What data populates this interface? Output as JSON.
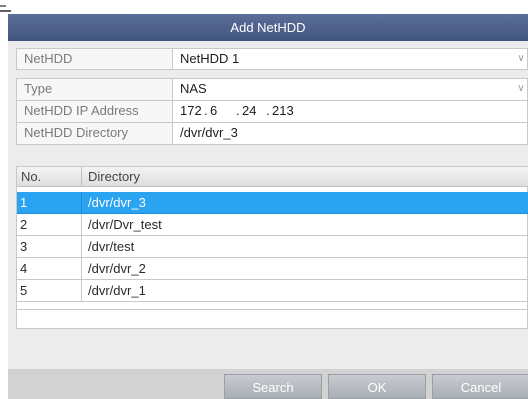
{
  "dialog": {
    "title": "Add NetHDD"
  },
  "form": {
    "nethdd": {
      "label": "NetHDD",
      "value": "NetHDD 1"
    },
    "type": {
      "label": "Type",
      "value": "NAS"
    },
    "ip": {
      "label": "NetHDD IP Address",
      "octets": [
        "172",
        "6",
        "24",
        "213"
      ]
    },
    "directory": {
      "label": "NetHDD Directory",
      "value": "/dvr/dvr_3"
    }
  },
  "table": {
    "headers": [
      "No.",
      "Directory"
    ],
    "rows": [
      {
        "no": "1",
        "dir": "/dvr/dvr_3",
        "selected": true
      },
      {
        "no": "2",
        "dir": "/dvr/Dvr_test"
      },
      {
        "no": "3",
        "dir": "/dvr/test"
      },
      {
        "no": "4",
        "dir": "/dvr/dvr_2"
      },
      {
        "no": "5",
        "dir": "/dvr/dvr_1"
      }
    ]
  },
  "buttons": {
    "search": "Search",
    "ok": "OK",
    "cancel": "Cancel"
  },
  "colors": {
    "title_bar": "#4c5f8a",
    "selection": "#2aa3f0",
    "button": "#b7bbc2"
  }
}
